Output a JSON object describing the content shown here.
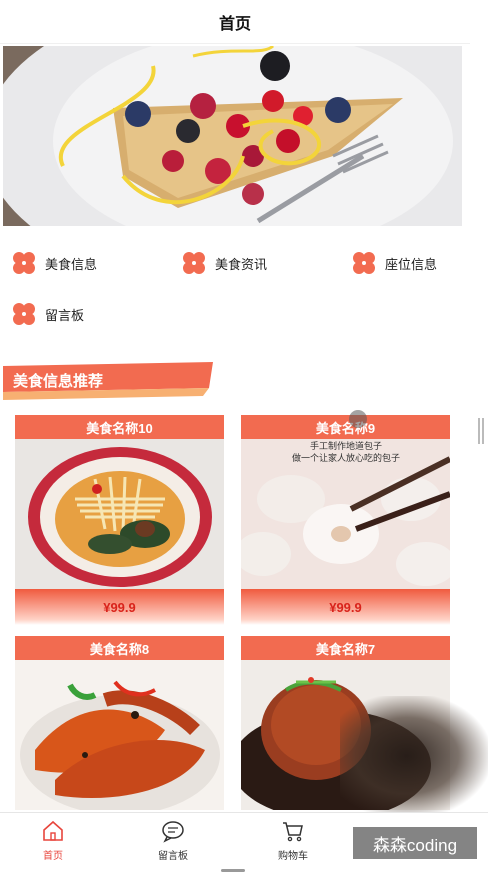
{
  "header": {
    "title": "首页"
  },
  "menu": {
    "items": [
      {
        "label": "美食信息",
        "icon": "clover-icon"
      },
      {
        "label": "美食资讯",
        "icon": "clover-icon"
      },
      {
        "label": "座位信息",
        "icon": "clover-icon"
      },
      {
        "label": "留言板",
        "icon": "clover-icon"
      }
    ]
  },
  "section": {
    "title": "美食信息推荐"
  },
  "cards": [
    {
      "name": "美食名称10",
      "price": "¥99.9"
    },
    {
      "name": "美食名称9",
      "price": "¥99.9",
      "image_caption_1": "手工制作地道包子",
      "image_caption_2": "做一个让家人放心吃的包子"
    },
    {
      "name": "美食名称8",
      "price": ""
    },
    {
      "name": "美食名称7",
      "price": ""
    }
  ],
  "tabbar": {
    "tabs": [
      {
        "label": "首页",
        "icon": "home-icon",
        "active": true
      },
      {
        "label": "留言板",
        "icon": "message-bubble-icon",
        "active": false
      },
      {
        "label": "购物车",
        "icon": "cart-icon",
        "active": false
      }
    ]
  },
  "watermark": {
    "text": "森森coding"
  },
  "colors": {
    "accent": "#f26b50",
    "price": "#d9231b",
    "active_tab": "#e8453c"
  }
}
